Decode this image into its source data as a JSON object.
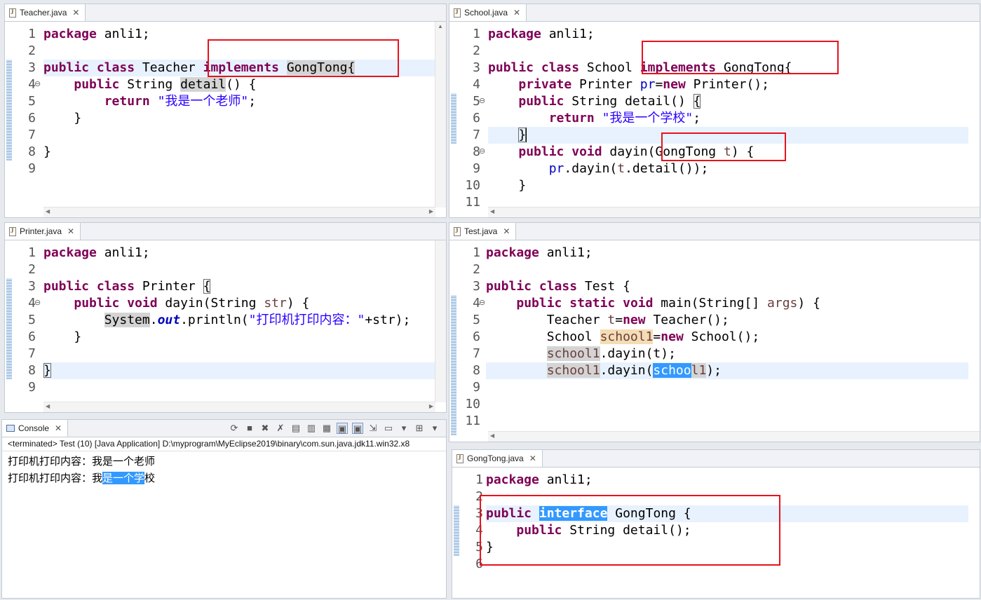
{
  "teacher": {
    "tab": "Teacher.java",
    "lines": [
      "1",
      "2",
      "3",
      "4",
      "5",
      "6",
      "7",
      "8",
      "9"
    ]
  },
  "school": {
    "tab": "School.java",
    "lines": [
      "1",
      "2",
      "3",
      "4",
      "5",
      "6",
      "7",
      "8",
      "9",
      "10",
      "11"
    ]
  },
  "printer": {
    "tab": "Printer.java",
    "lines": [
      "1",
      "2",
      "3",
      "4",
      "5",
      "6",
      "7",
      "8",
      "9"
    ]
  },
  "test": {
    "tab": "Test.java",
    "lines": [
      "1",
      "2",
      "3",
      "4",
      "5",
      "6",
      "7",
      "8",
      "9",
      "10",
      "11"
    ]
  },
  "gongtong": {
    "tab": "GongTong.java",
    "lines": [
      "1",
      "2",
      "3",
      "4",
      "5",
      "6"
    ]
  },
  "console": {
    "tab": "Console",
    "status": "<terminated> Test (10) [Java Application] D:\\myprogram\\MyEclipse2019\\binary\\com.sun.java.jdk11.win32.x8",
    "out1": "打印机打印内容：我是一个老师",
    "out2_pre": "打印机打印内容：我",
    "out2_sel": "是一个学",
    "out2_post": "校"
  },
  "code": {
    "package_kw": "package",
    "package_name": " anli1;",
    "public": "public",
    "private": "private",
    "class": "class",
    "interface": "interface",
    "implements": "implements",
    "return": "return",
    "void": "void",
    "static": "static",
    "new": "new",
    "teacher_class": " Teacher ",
    "gongtong": "GongTong",
    "brace_open": "{",
    "brace_close": "}",
    "string_type": " String ",
    "detail": "detail",
    "parens": "() {",
    "teacher_str": "\"我是一个老师\"",
    "semicolon": ";",
    "school_class": " School ",
    "printer_decl": " Printer ",
    "pr": "pr",
    "eq": "=",
    "printer_ctor": " Printer();",
    "detail_sig": "() ",
    "school_str": "\"我是一个学校\"",
    "dayin": " dayin(",
    "t": "t",
    "gt_param_close": ") {",
    "pr_call_tail": ".dayin(",
    "detail_call": ".detail());",
    "printer_class": " Printer ",
    "str_type": "String ",
    "str": "str",
    "system": "System",
    "dot": ".",
    "out": "out",
    "println": ".println(",
    "printer_str": "\"打印机打印内容：\"",
    "plus_str": "+str);",
    "test_class": " Test {",
    "main_sig": " main(String[] ",
    "args": "args",
    "teacher_type": "Teacher ",
    "teacher_ctor": " Teacher();",
    "school_type": "School ",
    "school1": "school1",
    "school_ctor": " School();",
    "dayin_t": ".dayin(t);",
    "dayin_open": ".dayin(",
    "schoo": "schoo",
    "l1": "l1",
    "close_paren": ");",
    "gt_iface": " GongTong {",
    "detail_decl": " String detail();",
    "gt_brace": "GongTong{",
    "sp": " "
  }
}
